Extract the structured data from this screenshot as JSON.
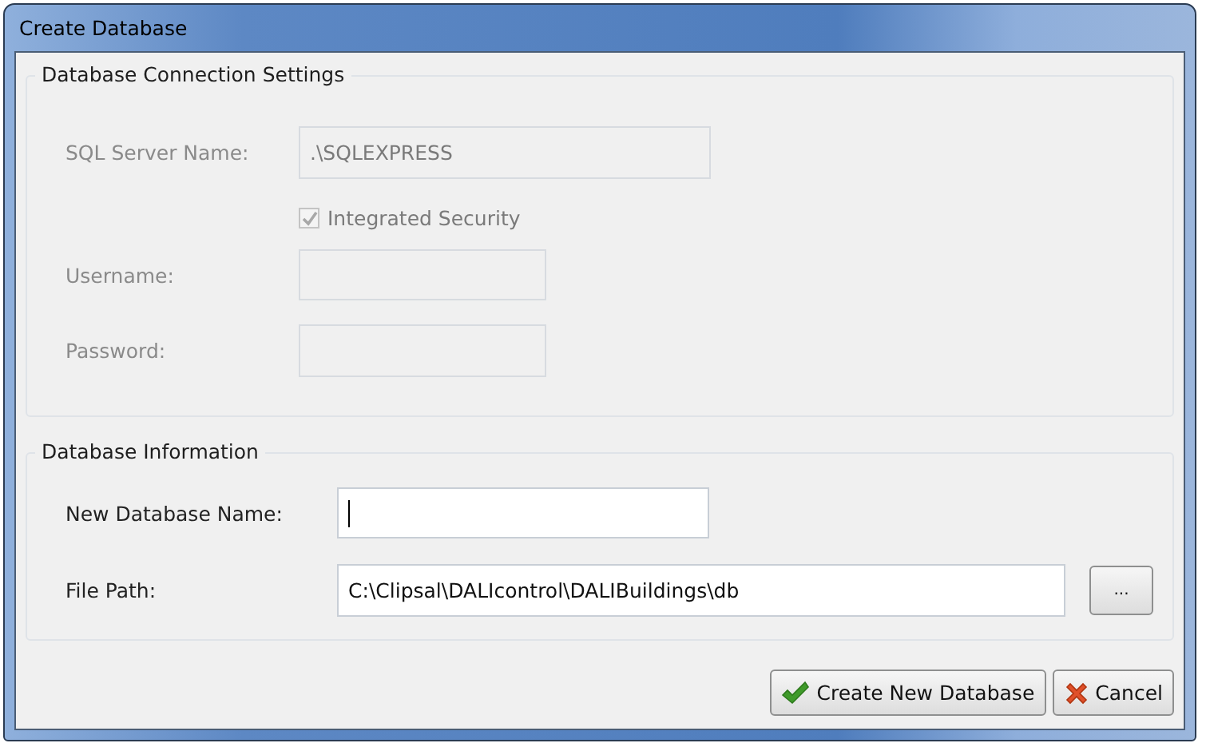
{
  "window": {
    "title": "Create Database"
  },
  "connection": {
    "title": "Database Connection Settings",
    "disabled": true,
    "server": {
      "label": "SQL Server Name:",
      "value": ".\\SQLEXPRESS"
    },
    "integrated_security": {
      "label": "Integrated Security",
      "checked": true
    },
    "username": {
      "label": "Username:"
    },
    "password": {
      "label": "Password:"
    }
  },
  "info": {
    "title": "Database Information",
    "name": {
      "label": "New Database Name:",
      "focused": true
    },
    "path": {
      "label": "File Path:",
      "value": "C:\\Clipsal\\DALIcontrol\\DALIBuildings\\db"
    },
    "browse": "..."
  },
  "buttons": [
    {
      "kind": "ok",
      "label": "Create New Database"
    },
    {
      "kind": "cancel",
      "label": "Cancel"
    }
  ]
}
